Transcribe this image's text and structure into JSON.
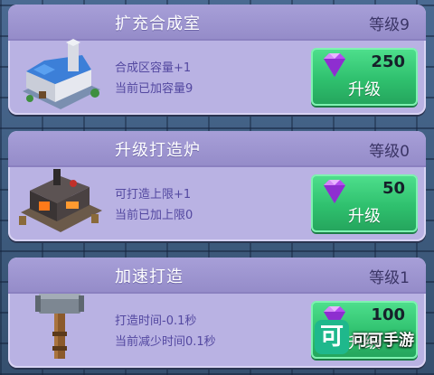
{
  "cards": [
    {
      "title": "扩充合成室",
      "level": "等级9",
      "desc1": "合成区容量+1",
      "desc2": "当前已加容量9",
      "art": "castle-building-icon",
      "cost": "250",
      "button_label": "升级"
    },
    {
      "title": "升级打造炉",
      "level": "等级0",
      "desc1": "可打造上限+1",
      "desc2": "当前已加上限0",
      "art": "forge-building-icon",
      "cost": "50",
      "button_label": "升级"
    },
    {
      "title": "加速打造",
      "level": "等级1",
      "desc1": "打造时间-0.1秒",
      "desc2": "当前减少时间0.1秒",
      "art": "hammer-icon",
      "cost": "100",
      "button_label": "升级"
    }
  ],
  "currency_icon": "purple-gem-icon",
  "watermark": {
    "logo_char": "可",
    "text": "可可手游"
  },
  "colors": {
    "card_bg": "#b9b2e3",
    "card_header": "#958cc9",
    "button_green": "#2fc06e",
    "desc_text": "#5348a0",
    "gem_purple": "#b44cf0"
  }
}
